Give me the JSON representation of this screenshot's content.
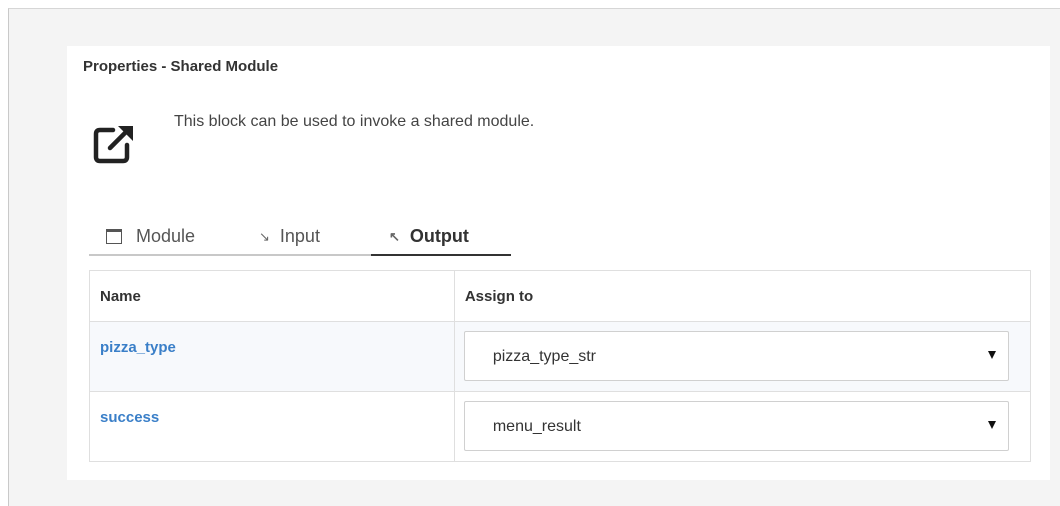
{
  "panel": {
    "title": "Properties - Shared Module",
    "icon": "external-link-icon",
    "description": "This block can be used to invoke a shared module."
  },
  "tabs": [
    {
      "label": "Module",
      "icon": "window-icon",
      "active": false
    },
    {
      "label": "Input",
      "icon": "arrow-in-icon",
      "active": false
    },
    {
      "label": "Output",
      "icon": "arrow-out-icon",
      "active": true
    }
  ],
  "table": {
    "columns": [
      "Name",
      "Assign to"
    ],
    "rows": [
      {
        "name": "pizza_type",
        "assign_to": "pizza_type_str"
      },
      {
        "name": "success",
        "assign_to": "menu_result"
      }
    ]
  },
  "colors": {
    "link": "#3a7fc8",
    "background": "#f4f4f4",
    "active_tab_underline": "#333333"
  }
}
